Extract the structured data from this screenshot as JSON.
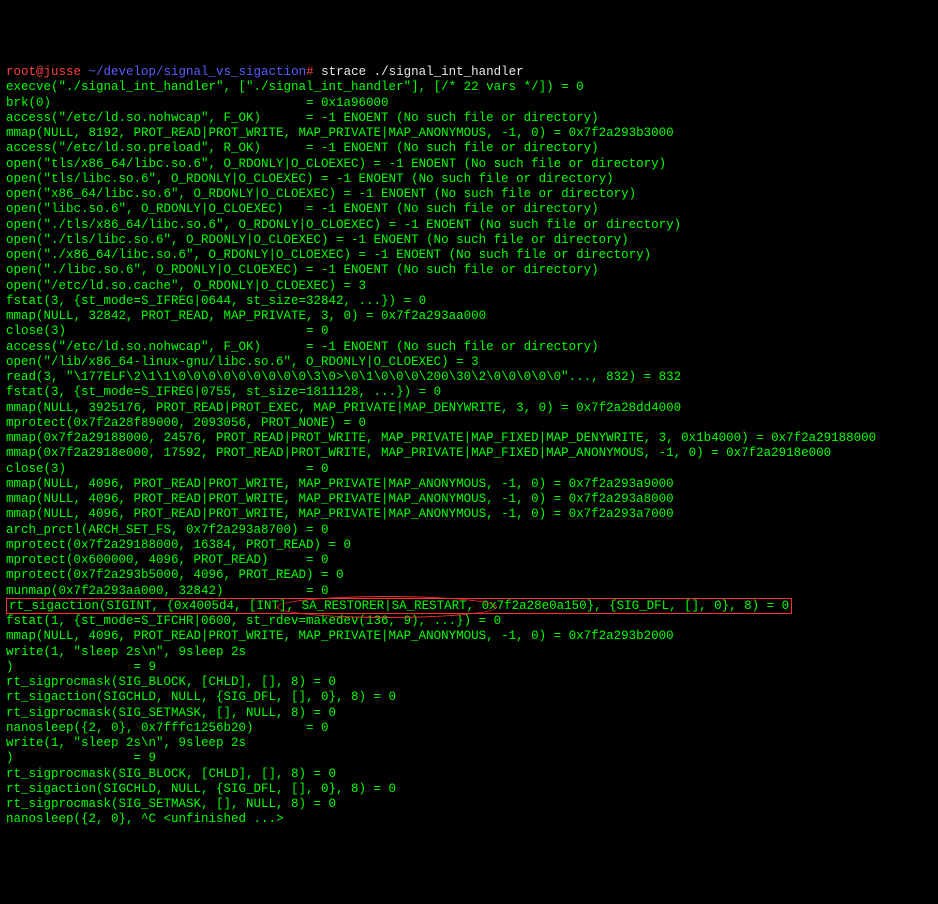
{
  "prompt": {
    "user": "root@jusse",
    "sep1": " ",
    "path": "~/develop/signal_vs_sigaction",
    "hash": "#",
    "cmd": " strace ./signal_int_handler"
  },
  "lines": [
    "execve(\"./signal_int_handler\", [\"./signal_int_handler\"], [/* 22 vars */]) = 0",
    "brk(0)                                  = 0x1a96000",
    "access(\"/etc/ld.so.nohwcap\", F_OK)      = -1 ENOENT (No such file or directory)",
    "mmap(NULL, 8192, PROT_READ|PROT_WRITE, MAP_PRIVATE|MAP_ANONYMOUS, -1, 0) = 0x7f2a293b3000",
    "access(\"/etc/ld.so.preload\", R_OK)      = -1 ENOENT (No such file or directory)",
    "open(\"tls/x86_64/libc.so.6\", O_RDONLY|O_CLOEXEC) = -1 ENOENT (No such file or directory)",
    "open(\"tls/libc.so.6\", O_RDONLY|O_CLOEXEC) = -1 ENOENT (No such file or directory)",
    "open(\"x86_64/libc.so.6\", O_RDONLY|O_CLOEXEC) = -1 ENOENT (No such file or directory)",
    "open(\"libc.so.6\", O_RDONLY|O_CLOEXEC)   = -1 ENOENT (No such file or directory)",
    "open(\"./tls/x86_64/libc.so.6\", O_RDONLY|O_CLOEXEC) = -1 ENOENT (No such file or directory)",
    "open(\"./tls/libc.so.6\", O_RDONLY|O_CLOEXEC) = -1 ENOENT (No such file or directory)",
    "open(\"./x86_64/libc.so.6\", O_RDONLY|O_CLOEXEC) = -1 ENOENT (No such file or directory)",
    "open(\"./libc.so.6\", O_RDONLY|O_CLOEXEC) = -1 ENOENT (No such file or directory)",
    "open(\"/etc/ld.so.cache\", O_RDONLY|O_CLOEXEC) = 3",
    "fstat(3, {st_mode=S_IFREG|0644, st_size=32842, ...}) = 0",
    "mmap(NULL, 32842, PROT_READ, MAP_PRIVATE, 3, 0) = 0x7f2a293aa000",
    "close(3)                                = 0",
    "access(\"/etc/ld.so.nohwcap\", F_OK)      = -1 ENOENT (No such file or directory)",
    "open(\"/lib/x86_64-linux-gnu/libc.so.6\", O_RDONLY|O_CLOEXEC) = 3",
    "read(3, \"\\177ELF\\2\\1\\1\\0\\0\\0\\0\\0\\0\\0\\0\\0\\3\\0>\\0\\1\\0\\0\\0\\200\\30\\2\\0\\0\\0\\0\\0\"..., 832) = 832",
    "fstat(3, {st_mode=S_IFREG|0755, st_size=1811128, ...}) = 0",
    "mmap(NULL, 3925176, PROT_READ|PROT_EXEC, MAP_PRIVATE|MAP_DENYWRITE, 3, 0) = 0x7f2a28dd4000",
    "mprotect(0x7f2a28f89000, 2093056, PROT_NONE) = 0",
    "mmap(0x7f2a29188000, 24576, PROT_READ|PROT_WRITE, MAP_PRIVATE|MAP_FIXED|MAP_DENYWRITE, 3, 0x1b4000) = 0x7f2a29188000",
    "mmap(0x7f2a2918e000, 17592, PROT_READ|PROT_WRITE, MAP_PRIVATE|MAP_FIXED|MAP_ANONYMOUS, -1, 0) = 0x7f2a2918e000",
    "close(3)                                = 0",
    "mmap(NULL, 4096, PROT_READ|PROT_WRITE, MAP_PRIVATE|MAP_ANONYMOUS, -1, 0) = 0x7f2a293a9000",
    "mmap(NULL, 4096, PROT_READ|PROT_WRITE, MAP_PRIVATE|MAP_ANONYMOUS, -1, 0) = 0x7f2a293a8000",
    "mmap(NULL, 4096, PROT_READ|PROT_WRITE, MAP_PRIVATE|MAP_ANONYMOUS, -1, 0) = 0x7f2a293a7000",
    "arch_prctl(ARCH_SET_FS, 0x7f2a293a8700) = 0",
    "mprotect(0x7f2a29188000, 16384, PROT_READ) = 0",
    "mprotect(0x600000, 4096, PROT_READ)     = 0",
    "mprotect(0x7f2a293b5000, 4096, PROT_READ) = 0",
    "munmap(0x7f2a293aa000, 32842)           = 0"
  ],
  "highlight": {
    "pre": "rt_sigaction(SIGINT, {0x4005d4, [INT], ",
    "circled": "SA_RESTORER|SA_RESTART,",
    "post": " 0x7f2a28e0a150}, {SIG_DFL, [], 0}, 8) = 0"
  },
  "lines2": [
    "fstat(1, {st_mode=S_IFCHR|0600, st_rdev=makedev(136, 9), ...}) = 0",
    "mmap(NULL, 4096, PROT_READ|PROT_WRITE, MAP_PRIVATE|MAP_ANONYMOUS, -1, 0) = 0x7f2a293b2000",
    "write(1, \"sleep 2s\\n\", 9sleep 2s",
    ")                = 9",
    "rt_sigprocmask(SIG_BLOCK, [CHLD], [], 8) = 0",
    "rt_sigaction(SIGCHLD, NULL, {SIG_DFL, [], 0}, 8) = 0",
    "rt_sigprocmask(SIG_SETMASK, [], NULL, 8) = 0",
    "nanosleep({2, 0}, 0x7fffc1256b20)       = 0",
    "write(1, \"sleep 2s\\n\", 9sleep 2s",
    ")                = 9",
    "rt_sigprocmask(SIG_BLOCK, [CHLD], [], 8) = 0",
    "rt_sigaction(SIGCHLD, NULL, {SIG_DFL, [], 0}, 8) = 0",
    "rt_sigprocmask(SIG_SETMASK, [], NULL, 8) = 0",
    "nanosleep({2, 0}, ^C <unfinished ...>"
  ]
}
